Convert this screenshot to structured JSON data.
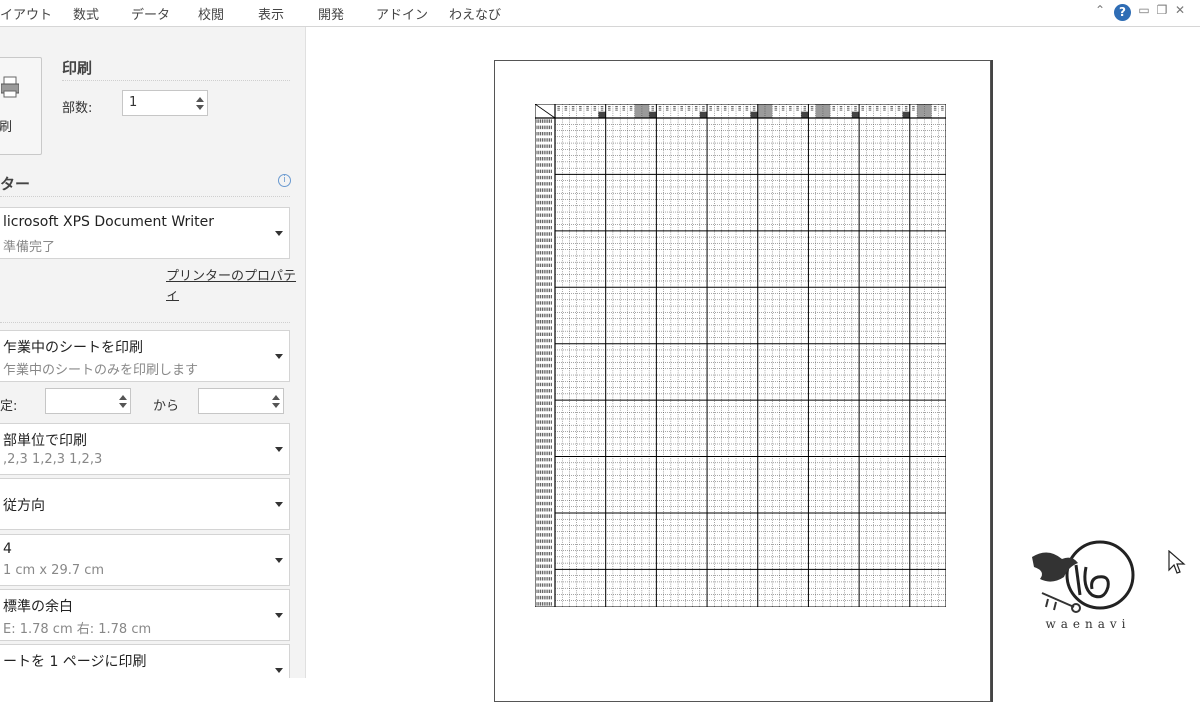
{
  "ribbon": {
    "tabs": [
      "イアウト",
      "数式",
      "データ",
      "校閲",
      "表示",
      "開発",
      "アドイン",
      "わえなび"
    ]
  },
  "window_controls": {
    "help": "?"
  },
  "print": {
    "section_title": "印刷",
    "button_label": "刷",
    "copies_label": "部数:",
    "copies_value": "1"
  },
  "printer": {
    "section_title": "ター",
    "name": "licrosoft XPS Document Writer",
    "status": "準備完了",
    "properties_link": "プリンターのプロパティ"
  },
  "settings": {
    "scope_main": "乍業中のシートを印刷",
    "scope_sub": "乍業中のシートのみを印刷します",
    "pages_label": "定:",
    "pages_to_label": "から",
    "pages_from": "",
    "pages_to": "",
    "collate_main": "部単位で印刷",
    "collate_sub": ",2,3    1,2,3    1,2,3",
    "orientation_main": "従方向",
    "paper_main": "4",
    "paper_sub": "1 cm x 29.7 cm",
    "margins_main": "標準の余白",
    "margins_sub": "E:  1.78 cm    右:  1.78 cm",
    "scaling_main": "ートを 1 ページに印刷"
  },
  "logo": {
    "text": "waenavi"
  },
  "colors": {
    "help_blue": "#2f6db5",
    "panel_bg": "#f3f3f3",
    "grid_line": "#000000",
    "header_shade": "#9a9a9a"
  }
}
